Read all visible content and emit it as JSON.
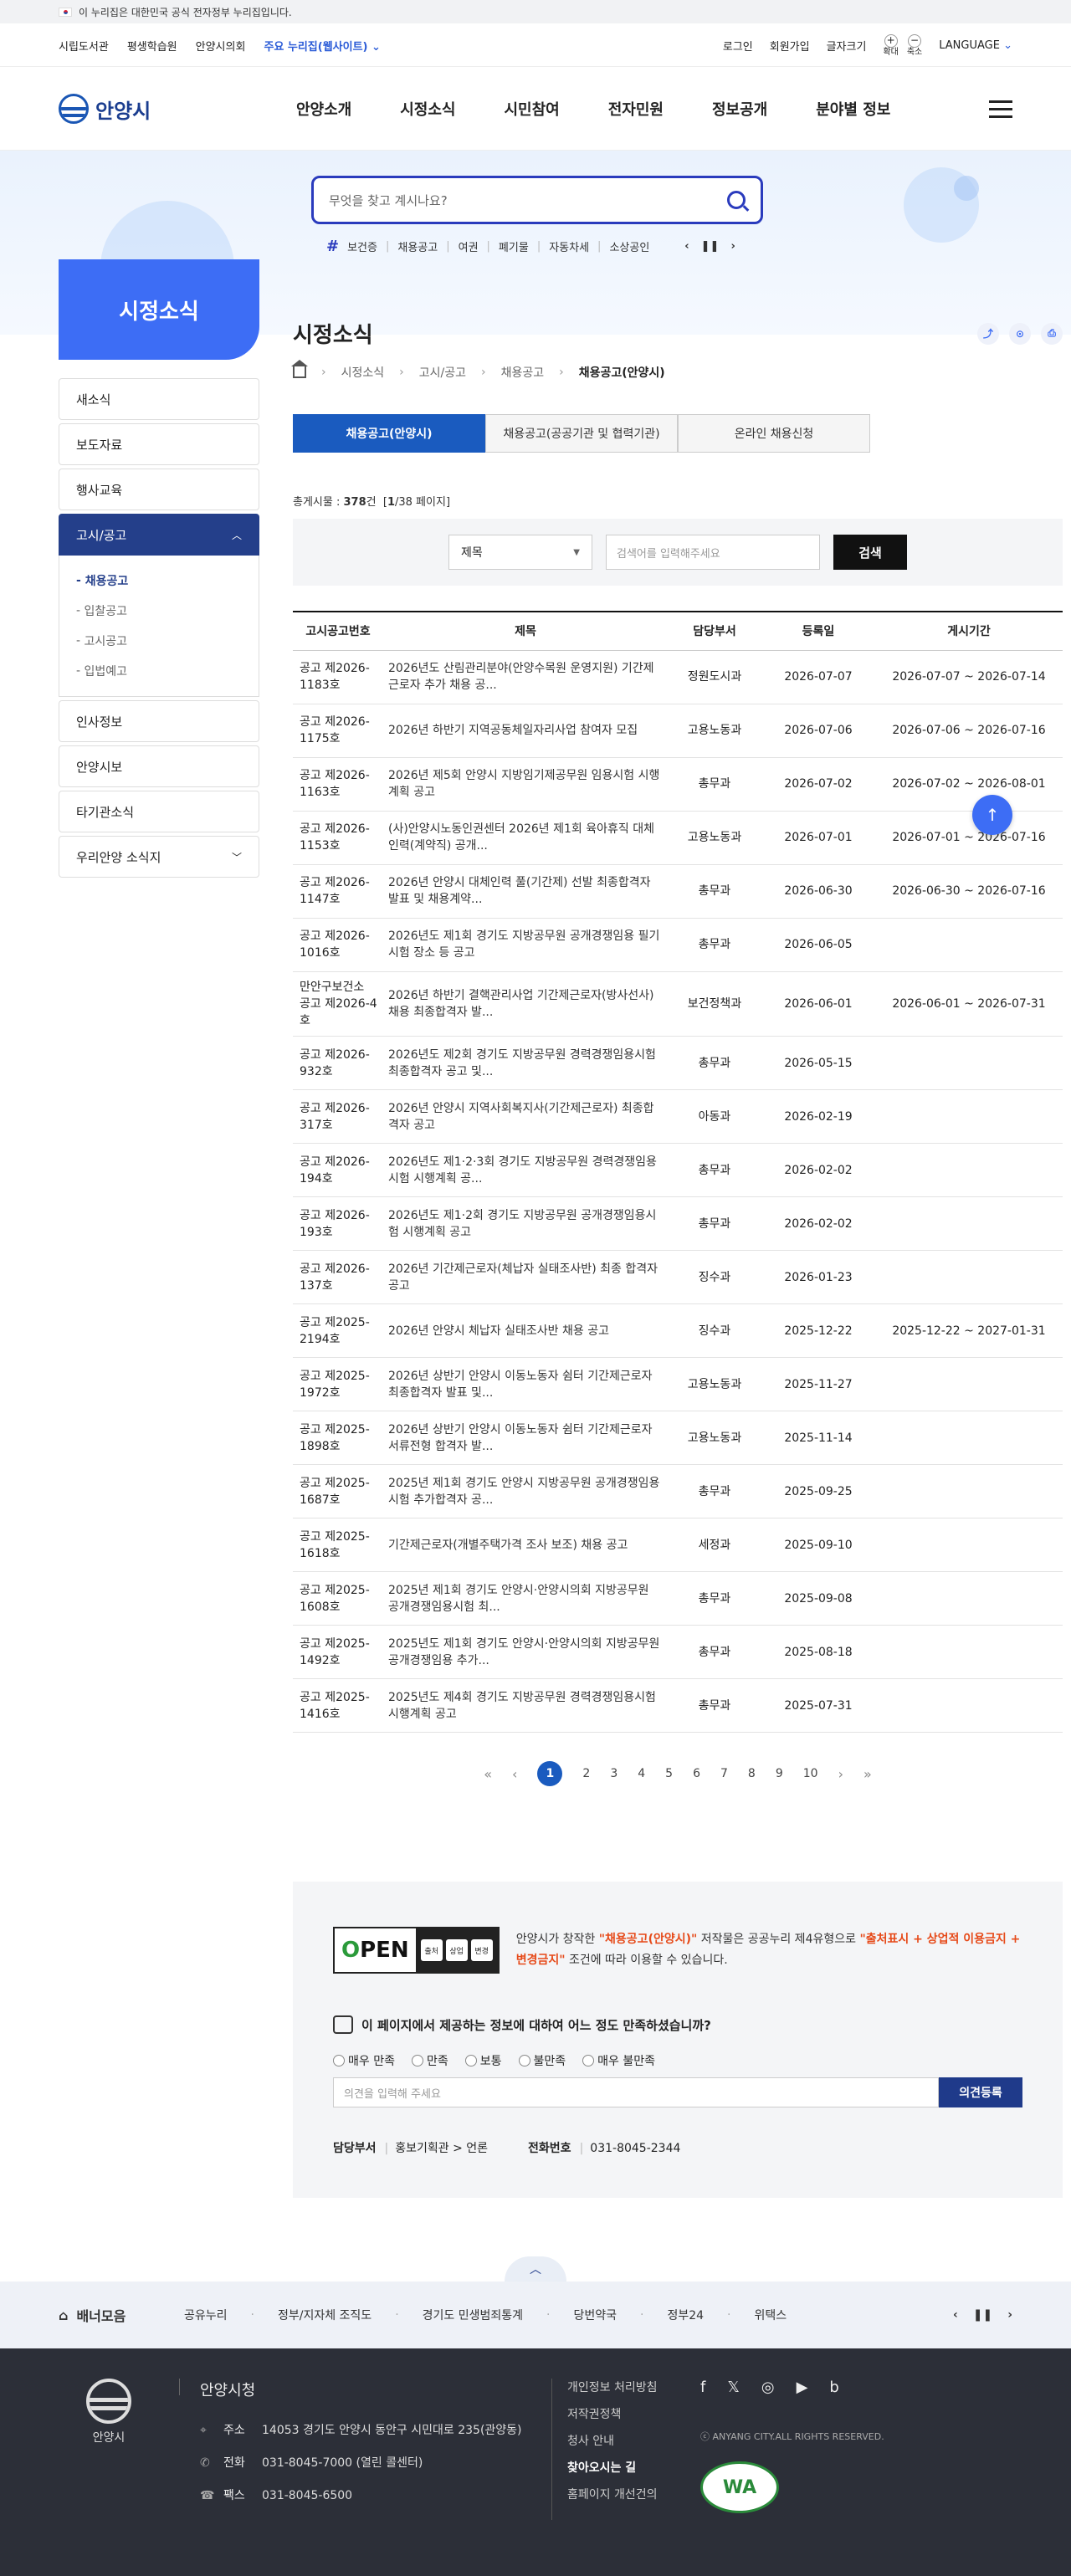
{
  "gov_banner": "이 누리집은 대한민국 공식 전자정부 누리집입니다.",
  "util": {
    "left": [
      "시립도서관",
      "평생학습원",
      "안양시의회",
      "주요 누리집(웹사이트)"
    ],
    "right": [
      "로그인",
      "회원가입",
      "글자크기"
    ],
    "zoom_in": "확대",
    "zoom_out": "축소",
    "language": "LANGUAGE"
  },
  "logo": "안양시",
  "gnb": [
    "안양소개",
    "시정소식",
    "시민참여",
    "전자민원",
    "정보공개",
    "분야별 정보"
  ],
  "search": {
    "placeholder": "무엇을 찾고 계시나요?",
    "keywords": [
      "보건증",
      "채용공고",
      "여권",
      "폐기물",
      "자동차세",
      "소상공인"
    ]
  },
  "lnb": {
    "title": "시정소식",
    "items": [
      "새소식",
      "보도자료",
      "행사교육",
      "고시/공고",
      "인사정보",
      "안양시보",
      "타기관소식",
      "우리안양 소식지"
    ],
    "sub": [
      "채용공고",
      "입찰공고",
      "고시공고",
      "입법예고"
    ]
  },
  "page": {
    "title": "시정소식",
    "breadcrumb": [
      "시정소식",
      "고시/공고",
      "채용공고",
      "채용공고(안양시)"
    ],
    "tabs": [
      "채용공고(안양시)",
      "채용공고(공공기관 및 협력기관)",
      "온라인 채용신청"
    ],
    "total_label": "총게시물 : ",
    "total_count": "378",
    "total_unit": "건",
    "page_info": "1",
    "page_total": "/38 페이지",
    "filter_select": "제목",
    "filter_placeholder": "검색어를 입력해주세요",
    "search_btn": "검색"
  },
  "table": {
    "headers": [
      "고시공고번호",
      "제목",
      "담당부서",
      "등록일",
      "게시기간"
    ],
    "rows": [
      [
        "공고 제2026-1183호",
        "2026년도 산림관리분야(안양수목원 운영지원) 기간제근로자 추가 채용 공...",
        "정원도시과",
        "2026-07-07",
        "2026-07-07 ~ 2026-07-14"
      ],
      [
        "공고 제2026-1175호",
        "2026년 하반기 지역공동체일자리사업 참여자 모집",
        "고용노동과",
        "2026-07-06",
        "2026-07-06 ~ 2026-07-16"
      ],
      [
        "공고 제2026-1163호",
        "2026년 제5회 안양시 지방임기제공무원 임용시험 시행계획 공고",
        "총무과",
        "2026-07-02",
        "2026-07-02 ~ 2026-08-01"
      ],
      [
        "공고 제2026-1153호",
        "(사)안양시노동인권센터 2026년 제1회 육아휴직 대체인력(계약직) 공개...",
        "고용노동과",
        "2026-07-01",
        "2026-07-01 ~ 2026-07-16"
      ],
      [
        "공고 제2026-1147호",
        "2026년 안양시 대체인력 풀(기간제) 선발 최종합격자 발표 및 채용계약...",
        "총무과",
        "2026-06-30",
        "2026-06-30 ~ 2026-07-16"
      ],
      [
        "공고 제2026-1016호",
        "2026년도 제1회 경기도 지방공무원 공개경쟁임용 필기시험 장소 등 공고",
        "총무과",
        "2026-06-05",
        ""
      ],
      [
        "만안구보건소 공고 제2026-4호",
        "2026년 하반기 결핵관리사업 기간제근로자(방사선사) 채용 최종합격자 발...",
        "보건정책과",
        "2026-06-01",
        "2026-06-01 ~ 2026-07-31"
      ],
      [
        "공고 제2026-932호",
        "2026년도 제2회 경기도 지방공무원 경력경쟁임용시험 최종합격자 공고 및...",
        "총무과",
        "2026-05-15",
        ""
      ],
      [
        "공고 제2026-317호",
        "2026년 안양시 지역사회복지사(기간제근로자) 최종합격자 공고",
        "아동과",
        "2026-02-19",
        ""
      ],
      [
        "공고 제2026-194호",
        "2026년도 제1·2·3회 경기도 지방공무원 경력경쟁임용시험 시행계획 공...",
        "총무과",
        "2026-02-02",
        ""
      ],
      [
        "공고 제2026-193호",
        "2026년도 제1·2회 경기도 지방공무원 공개경쟁임용시험 시행계획 공고",
        "총무과",
        "2026-02-02",
        ""
      ],
      [
        "공고 제2026-137호",
        "2026년 기간제근로자(체납자 실태조사반) 최종 합격자 공고",
        "징수과",
        "2026-01-23",
        ""
      ],
      [
        "공고 제2025-2194호",
        "2026년 안양시 체납자 실태조사반 채용 공고",
        "징수과",
        "2025-12-22",
        "2025-12-22 ~ 2027-01-31"
      ],
      [
        "공고 제2025-1972호",
        "2026년 상반기 안양시 이동노동자 쉼터 기간제근로자 최종합격자 발표 및...",
        "고용노동과",
        "2025-11-27",
        ""
      ],
      [
        "공고 제2025-1898호",
        "2026년 상반기 안양시 이동노동자 쉼터 기간제근로자 서류전형 합격자 발...",
        "고용노동과",
        "2025-11-14",
        ""
      ],
      [
        "공고 제2025-1687호",
        "2025년 제1회 경기도 안양시 지방공무원 공개경쟁임용시험 추가합격자 공...",
        "총무과",
        "2025-09-25",
        ""
      ],
      [
        "공고 제2025-1618호",
        "기간제근로자(개별주택가격 조사 보조) 채용 공고",
        "세정과",
        "2025-09-10",
        ""
      ],
      [
        "공고 제2025-1608호",
        "2025년 제1회 경기도 안양시·안양시의회 지방공무원 공개경쟁임용시험 최...",
        "총무과",
        "2025-09-08",
        ""
      ],
      [
        "공고 제2025-1492호",
        "2025년도 제1회 경기도 안양시·안양시의회 지방공무원 공개경쟁임용 추가...",
        "총무과",
        "2025-08-18",
        ""
      ],
      [
        "공고 제2025-1416호",
        "2025년도 제4회 경기도 지방공무원 경력경쟁임용시험 시행계획 공고",
        "총무과",
        "2025-07-31",
        ""
      ]
    ]
  },
  "paging": [
    "1",
    "2",
    "3",
    "4",
    "5",
    "6",
    "7",
    "8",
    "9",
    "10"
  ],
  "license": {
    "t1": "안양시가 창작한 ",
    "t2": "\"채용공고(안양시)\"",
    "t3": " 저작물은 공공누리 제4유형으로 ",
    "t4": "\"출처표시 + 상업적 이용금지 + 변경금지\"",
    "t5": " 조건에 따라 이용할 수 있습니다.",
    "open_o": "O",
    "open_rest": "PEN",
    "badges": [
      "출처",
      "상업",
      "변경"
    ]
  },
  "survey": {
    "question": "이 페이지에서 제공하는 정보에 대하여 어느 정도 만족하셨습니까?",
    "options": [
      "매우 만족",
      "만족",
      "보통",
      "불만족",
      "매우 불만족"
    ],
    "placeholder": "의견을 입력해 주세요",
    "submit": "의견등록",
    "dept_label": "담당부서",
    "dept_value": "홍보기획관 > 언론",
    "tel_label": "전화번호",
    "tel_value": "031-8045-2344"
  },
  "banners": {
    "title": "배너모음",
    "items": [
      "공유누리",
      "정부/지자체 조직도",
      "경기도 민생범죄통계",
      "당번약국",
      "정부24",
      "위택스"
    ]
  },
  "footer": {
    "logo": "안양시",
    "name": "안양시청",
    "addr_label": "주소",
    "addr": "14053 경기도 안양시 동안구 시민대로 235(관양동)",
    "tel_label": "전화",
    "tel": "031-8045-7000 (열린 콜센터)",
    "fax_label": "팩스",
    "fax": "031-8045-6500",
    "links": [
      "개인정보 처리방침",
      "저작권정책",
      "청사 안내",
      "찾아오시는 길",
      "홈페이지 개선건의"
    ],
    "copyright": "ⓒ ANYANG CITY.ALL RIGHTS RESERVED.",
    "wa": "WA"
  },
  "colors": {
    "primary": "#3d6df5",
    "tab": "#1a5bbf",
    "lnb_active": "#243f8a",
    "footer": "#2c2f38"
  }
}
